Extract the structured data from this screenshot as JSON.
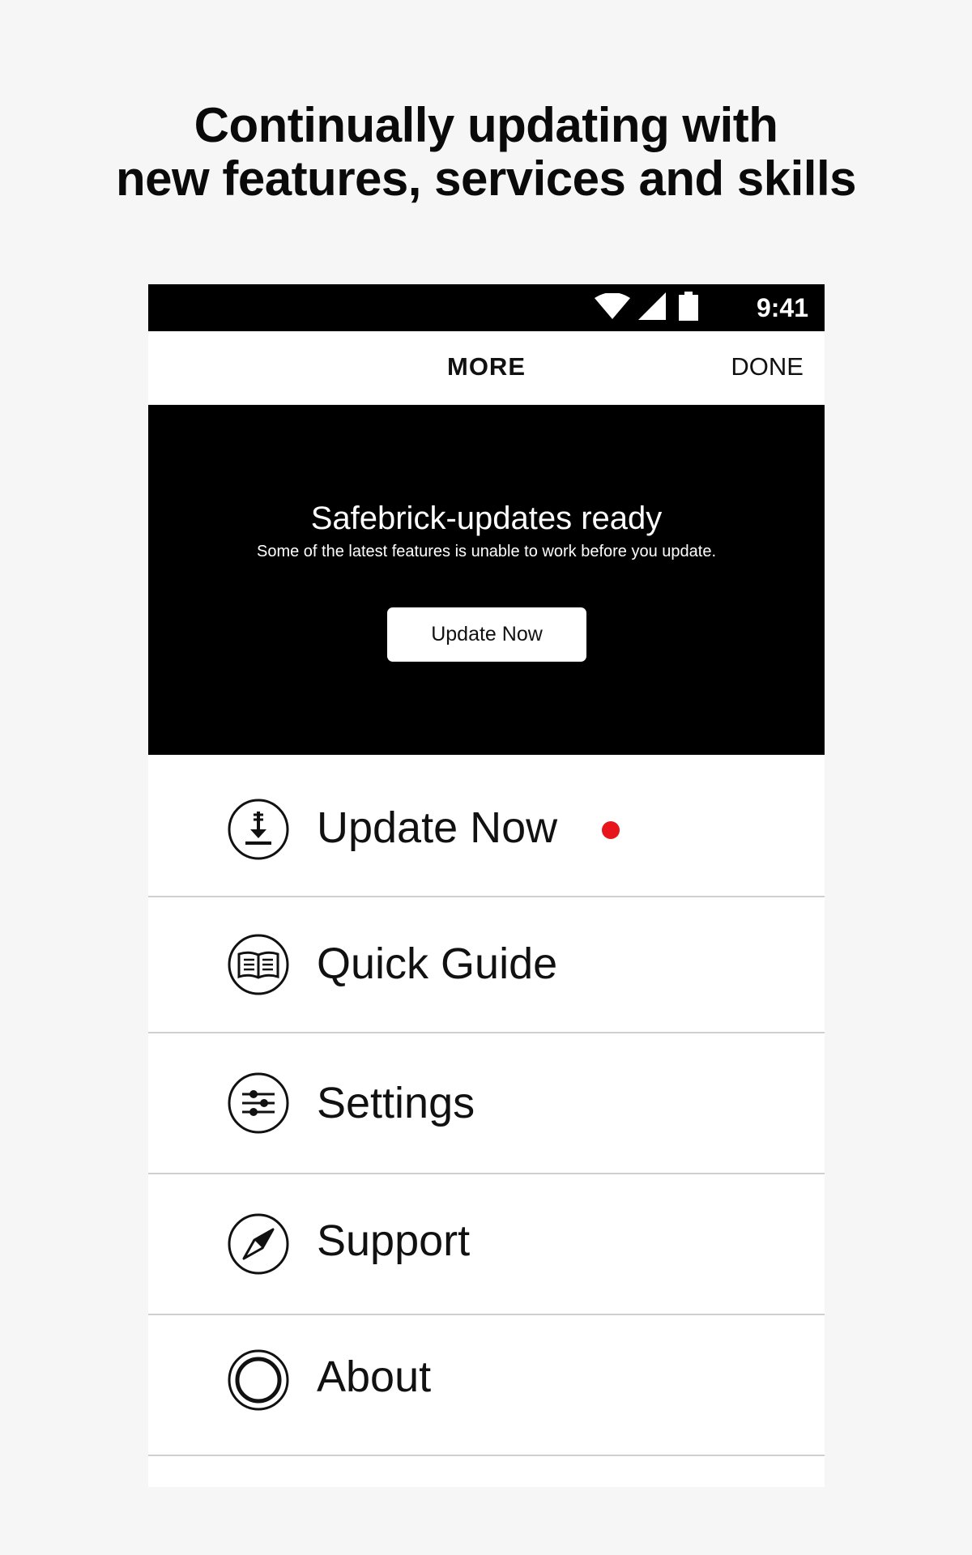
{
  "headline": {
    "line1": "Continually updating with",
    "line2": "new features, services and skills"
  },
  "status_bar": {
    "time": "9:41",
    "icons": [
      "wifi-icon",
      "cellular-signal-icon",
      "battery-icon"
    ]
  },
  "nav": {
    "title": "MORE",
    "done_label": "DONE"
  },
  "banner": {
    "title": "Safebrick-updates ready",
    "subtitle": "Some of the latest features is unable to work before you update.",
    "button_label": "Update Now"
  },
  "menu": {
    "items": [
      {
        "label": "Update Now",
        "icon": "download-icon",
        "badge": "red-dot"
      },
      {
        "label": "Quick Guide",
        "icon": "book-icon"
      },
      {
        "label": "Settings",
        "icon": "sliders-icon"
      },
      {
        "label": "Support",
        "icon": "compass-icon"
      },
      {
        "label": "About",
        "icon": "ring-icon"
      }
    ]
  },
  "colors": {
    "page_background": "#f6f6f6",
    "banner_background": "#000000",
    "badge_red": "#e8141c",
    "divider": "#cfcfcf"
  }
}
